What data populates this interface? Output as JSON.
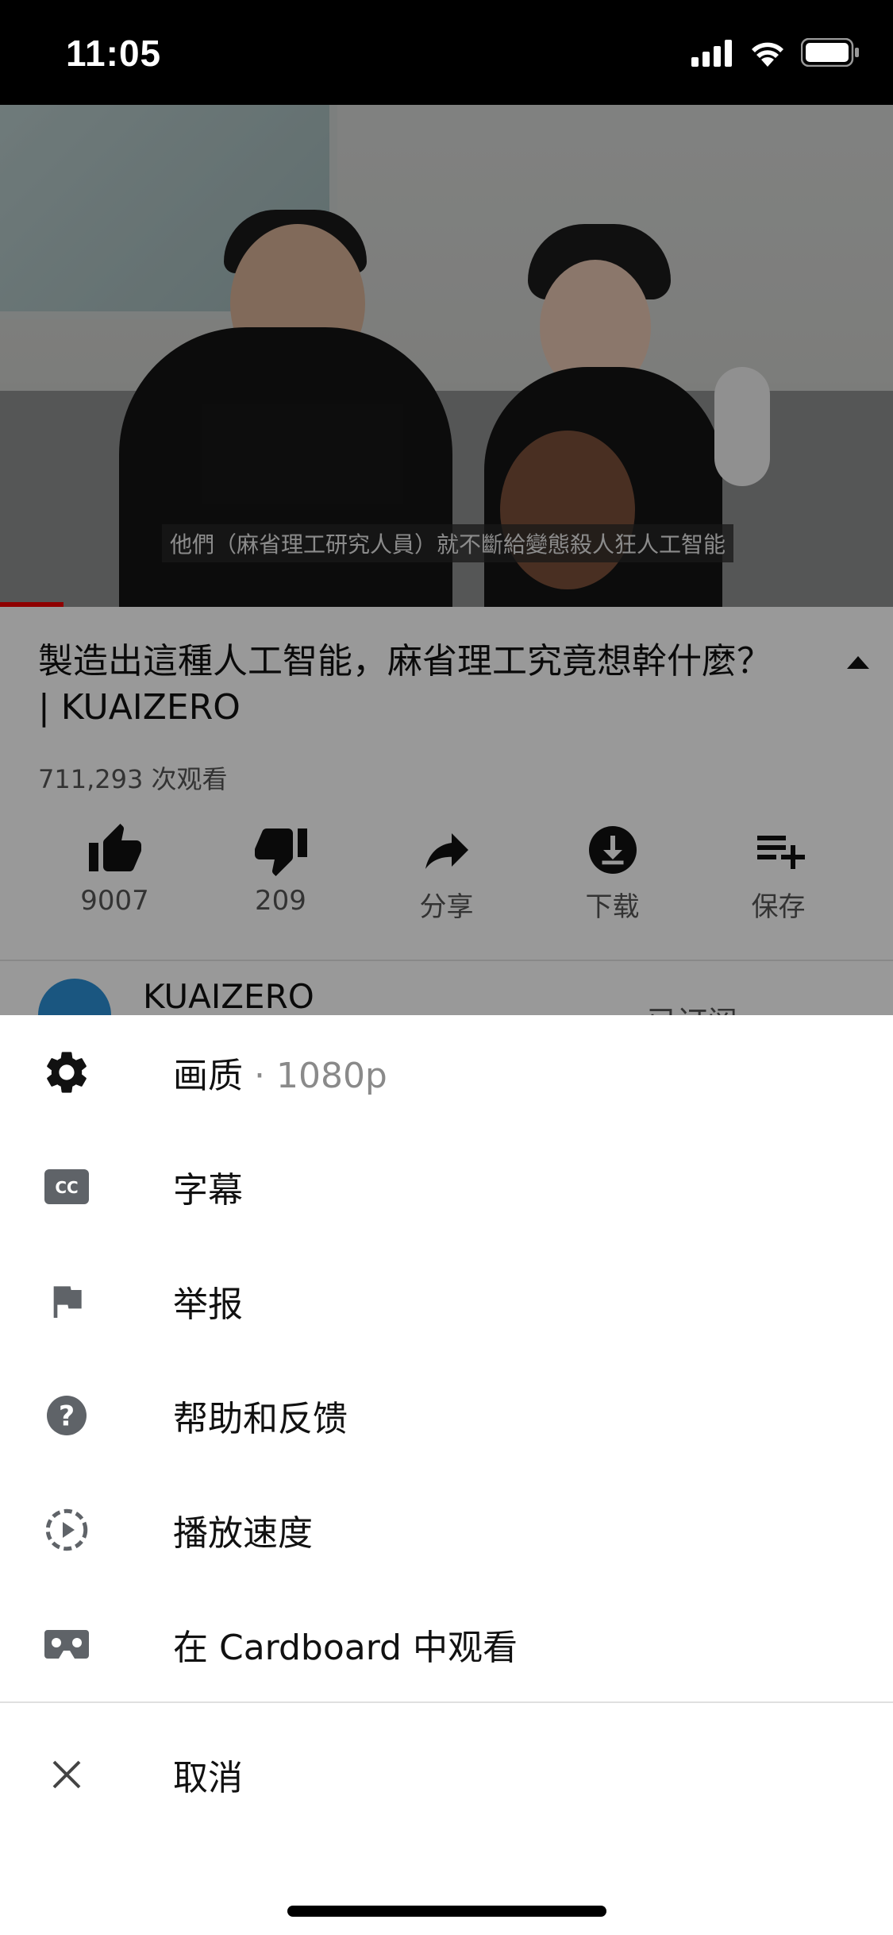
{
  "status_bar": {
    "time": "11:05"
  },
  "video": {
    "caption": "他們（麻省理工研究人員）就不斷給變態殺人狂人工智能"
  },
  "details": {
    "title": "製造出這種人工智能，麻省理工究竟想幹什麼？ | KUAIZERO",
    "views": "711,293 次观看",
    "actions": [
      {
        "icon": "thumb-up-icon",
        "label": "9007"
      },
      {
        "icon": "thumb-down-icon",
        "label": "209"
      },
      {
        "icon": "share-icon",
        "label": "分享"
      },
      {
        "icon": "download-icon",
        "label": "下载"
      },
      {
        "icon": "playlist-add-icon",
        "label": "保存"
      }
    ],
    "channel": {
      "name": "KUAIZERO",
      "subscribed_label": "已订阅"
    }
  },
  "menu": {
    "items": [
      {
        "icon": "gear-icon",
        "label": "画质",
        "value": " · 1080p"
      },
      {
        "icon": "cc-icon",
        "label": "字幕"
      },
      {
        "icon": "flag-icon",
        "label": "举报"
      },
      {
        "icon": "help-icon",
        "label": "帮助和反馈"
      },
      {
        "icon": "playback-speed-icon",
        "label": "播放速度"
      },
      {
        "icon": "cardboard-icon",
        "label": "在 Cardboard 中观看"
      }
    ],
    "cancel": {
      "icon": "close-icon",
      "label": "取消"
    }
  }
}
